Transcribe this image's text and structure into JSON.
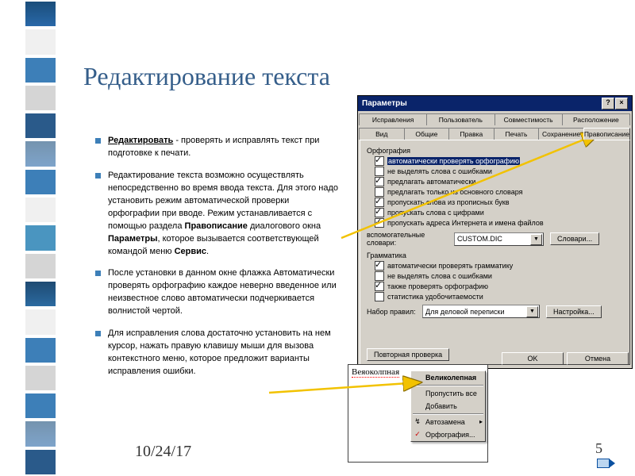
{
  "title": "Редактирование текста",
  "bullets": [
    {
      "pre": "Редактировать",
      "rest": " - проверять и исправлять текст при подготовке к печати."
    },
    {
      "text": "Редактирование текста возможно осуществлять непосредственно во время ввода текста. Для этого надо установить режим автоматической проверки орфографии при вводе. Режим устанавливается с помощью раздела ",
      "b2": "Правописание",
      "mid": " диалогового окна ",
      "b3": "Параметры",
      "mid2": ", которое вызывается соответствующей командой меню ",
      "b4": "Сервис",
      "end": "."
    },
    {
      "text": "После установки в данном окне флажка Автоматически проверять орфографию каждое неверно введенное или неизвестное слово автоматически подчеркивается волнистой чертой."
    },
    {
      "text": "Для исправления слова достаточно установить на нем курсор, нажать правую клавишу мыши для вызова контекстного меню, которое предложит варианты исправления ошибки."
    }
  ],
  "footer_date": "10/24/17",
  "footer_page": "5",
  "dialog": {
    "title": "Параметры",
    "tabs_row1": [
      "Исправления",
      "Пользователь",
      "Совместимость",
      "Расположение"
    ],
    "tabs_row2": [
      "Вид",
      "Общие",
      "Правка",
      "Печать",
      "Сохранение",
      "Правописание"
    ],
    "spelling_label": "Орфография",
    "spelling_checks": [
      {
        "label": "автоматически проверять орфографию",
        "checked": true,
        "hl": true
      },
      {
        "label": "не выделять слова с ошибками",
        "checked": false
      },
      {
        "label": "предлагать автоматически",
        "checked": true
      },
      {
        "label": "предлагать только из основного словаря",
        "checked": false
      },
      {
        "label": "пропускать слова из прописных букв",
        "checked": true
      },
      {
        "label": "пропускать слова с цифрами",
        "checked": true
      },
      {
        "label": "пропускать адреса Интернета и имена файлов",
        "checked": true
      }
    ],
    "aux_label": "вспомогательные словари:",
    "aux_value": "CUSTOM.DIC",
    "aux_button": "Словари...",
    "grammar_label": "Грамматика",
    "grammar_checks": [
      {
        "label": "автоматически проверять грамматику",
        "checked": true
      },
      {
        "label": "не выделять слова с ошибками",
        "checked": false
      },
      {
        "label": "также проверять орфографию",
        "checked": true
      },
      {
        "label": "статистика удобочитаемости",
        "checked": false
      }
    ],
    "rules_label": "Набор правил:",
    "rules_value": "Для деловой переписки",
    "rules_button": "Настройка...",
    "recheck": "Повторная проверка",
    "ok": "OK",
    "cancel": "Отмена"
  },
  "context": {
    "wrong": "Веяоколпная",
    "items": [
      {
        "label": "Великолепная",
        "bold": true
      },
      {
        "label": "Пропустить все"
      },
      {
        "label": "Добавить"
      },
      {
        "label": "Автозамена",
        "icon": "↯",
        "sub": true
      },
      {
        "label": "Орфография...",
        "icon": "✓"
      }
    ]
  }
}
